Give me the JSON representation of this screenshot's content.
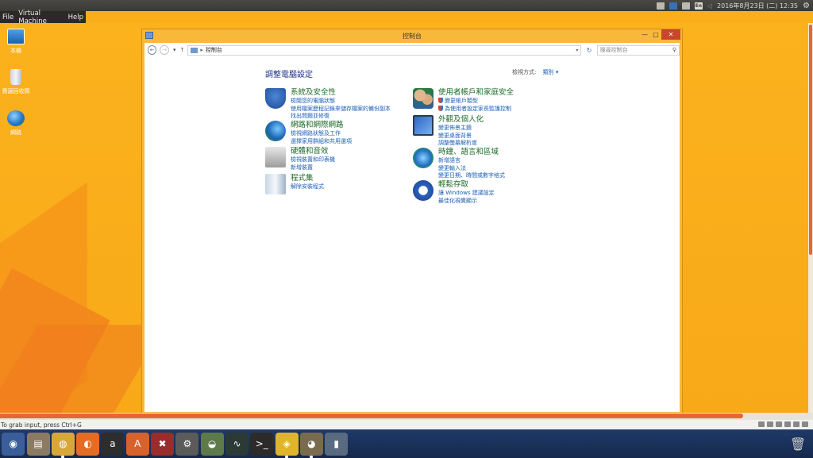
{
  "host_panel": {
    "clock": "2016年8月23日 (二) 12:35",
    "keyboard_indicator": "En"
  },
  "vm_menu": [
    "File",
    "Virtual Machine",
    "Help"
  ],
  "desktop": {
    "icons": [
      {
        "label": "本機",
        "icon": "computer-icon"
      },
      {
        "label": "資源回收筒",
        "icon": "recycle-bin-icon"
      },
      {
        "label": "網路",
        "icon": "network-icon"
      }
    ]
  },
  "window": {
    "title": "控制台",
    "breadcrumb": "控制台",
    "search_placeholder": "搜尋控制台",
    "heading": "調整電腦設定",
    "view_by_label": "檢視方式:",
    "view_by_value": "類別 ▾",
    "categories": [
      {
        "title": "系統及安全性",
        "icon": "system-security-icon",
        "links": [
          "檢閱您的電腦狀態",
          "使用檔案歷程記錄來儲存檔案的備份副本",
          "找出問題並修復"
        ]
      },
      {
        "title": "網路和網際網路",
        "icon": "network-internet-icon",
        "links": [
          "檢視網路狀態及工作",
          "選擇家用群組和共用選項"
        ]
      },
      {
        "title": "硬體和音效",
        "icon": "hardware-sound-icon",
        "links": [
          "檢視裝置和印表機",
          "新增裝置"
        ]
      },
      {
        "title": "程式集",
        "icon": "programs-icon",
        "links": [
          "解除安裝程式"
        ]
      },
      {
        "title": "使用者帳戶和家庭安全",
        "icon": "user-accounts-icon",
        "links": [
          "變更帳戶類型",
          "為使用者設定家長監護控制"
        ]
      },
      {
        "title": "外觀及個人化",
        "icon": "appearance-icon",
        "links": [
          "變更佈景主題",
          "變更桌面背景",
          "調整螢幕解析度"
        ]
      },
      {
        "title": "時鐘、語言和區域",
        "icon": "clock-region-icon",
        "links": [
          "新增語言",
          "變更輸入法",
          "變更日期、時間或數字格式"
        ]
      },
      {
        "title": "輕鬆存取",
        "icon": "ease-access-icon",
        "links": [
          "讓 Windows 建議設定",
          "最佳化視覺顯示"
        ]
      }
    ]
  },
  "vm_status": {
    "grab_hint": "To grab input, press Ctrl+G"
  },
  "dock": [
    {
      "name": "dash-icon",
      "glyph": "◉",
      "color": "#3b5e9a"
    },
    {
      "name": "files-icon",
      "glyph": "▤",
      "color": "#8c7a62"
    },
    {
      "name": "chrome-icon",
      "glyph": "◍",
      "color": "#d8a73a"
    },
    {
      "name": "firefox-icon",
      "glyph": "◐",
      "color": "#e46c23"
    },
    {
      "name": "app-a-icon",
      "glyph": "a",
      "color": "#2d2d2d"
    },
    {
      "name": "software-center-icon",
      "glyph": "A",
      "color": "#d7622c"
    },
    {
      "name": "settings-tool-icon",
      "glyph": "✖",
      "color": "#9a2c2c"
    },
    {
      "name": "system-settings-icon",
      "glyph": "⚙",
      "color": "#5b5b5b"
    },
    {
      "name": "disk-icon",
      "glyph": "◒",
      "color": "#5f7a4a"
    },
    {
      "name": "system-monitor-icon",
      "glyph": "∿",
      "color": "#2b3a34"
    },
    {
      "name": "terminal-icon",
      "glyph": ">_",
      "color": "#2d2b2a"
    },
    {
      "name": "vm-icon",
      "glyph": "◈",
      "color": "#e0b52b"
    },
    {
      "name": "gimp-icon",
      "glyph": "◕",
      "color": "#7a6a4e"
    },
    {
      "name": "usb-icon",
      "glyph": "▮",
      "color": "#596b80"
    }
  ]
}
